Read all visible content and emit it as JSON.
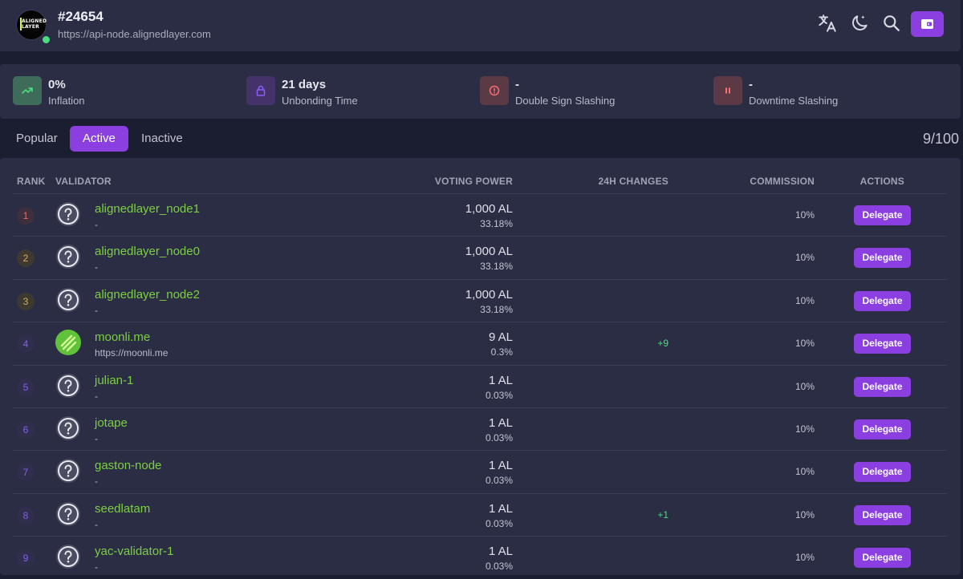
{
  "header": {
    "logo_text": "ALIGNED LAYER",
    "block_height": "#24654",
    "endpoint": "https://api-node.alignedlayer.com"
  },
  "stats": [
    {
      "value": "0%",
      "label": "Inflation",
      "icon": "trend-up-icon",
      "color": "#3e6b5a",
      "fg": "#4ade80"
    },
    {
      "value": "21 days",
      "label": "Unbonding Time",
      "icon": "lock-icon",
      "color": "#44336b",
      "fg": "#8b5cf6"
    },
    {
      "value": "-",
      "label": "Double Sign Slashing",
      "icon": "alert-circle-icon",
      "color": "#5b3a46",
      "fg": "#f87171"
    },
    {
      "value": "-",
      "label": "Downtime Slashing",
      "icon": "pause-icon",
      "color": "#5b3a46",
      "fg": "#f87171"
    }
  ],
  "tabs": {
    "popular": "Popular",
    "active": "Active",
    "inactive": "Inactive"
  },
  "count": "9/100",
  "table": {
    "headers": {
      "rank": "RANK",
      "validator": "VALIDATOR",
      "voting_power": "VOTING POWER",
      "changes": "24H CHANGES",
      "commission": "COMMISSION",
      "actions": "ACTIONS"
    },
    "action_label": "Delegate",
    "rows": [
      {
        "rank": "1",
        "name": "alignedlayer_node1",
        "site": "-",
        "power": "1,000 AL",
        "percent": "33.18%",
        "change": "",
        "commission": "10%"
      },
      {
        "rank": "2",
        "name": "alignedlayer_node0",
        "site": "-",
        "power": "1,000 AL",
        "percent": "33.18%",
        "change": "",
        "commission": "10%"
      },
      {
        "rank": "3",
        "name": "alignedlayer_node2",
        "site": "-",
        "power": "1,000 AL",
        "percent": "33.18%",
        "change": "",
        "commission": "10%"
      },
      {
        "rank": "4",
        "name": "moonli.me",
        "site": "https://moonli.me",
        "power": "9 AL",
        "percent": "0.3%",
        "change": "+9",
        "commission": "10%"
      },
      {
        "rank": "5",
        "name": "julian-1",
        "site": "-",
        "power": "1 AL",
        "percent": "0.03%",
        "change": "",
        "commission": "10%"
      },
      {
        "rank": "6",
        "name": "jotape",
        "site": "-",
        "power": "1 AL",
        "percent": "0.03%",
        "change": "",
        "commission": "10%"
      },
      {
        "rank": "7",
        "name": "gaston-node",
        "site": "-",
        "power": "1 AL",
        "percent": "0.03%",
        "change": "",
        "commission": "10%"
      },
      {
        "rank": "8",
        "name": "seedlatam",
        "site": "-",
        "power": "1 AL",
        "percent": "0.03%",
        "change": "+1",
        "commission": "10%"
      },
      {
        "rank": "9",
        "name": "yac-validator-1",
        "site": "-",
        "power": "1 AL",
        "percent": "0.03%",
        "change": "",
        "commission": "10%"
      }
    ]
  }
}
